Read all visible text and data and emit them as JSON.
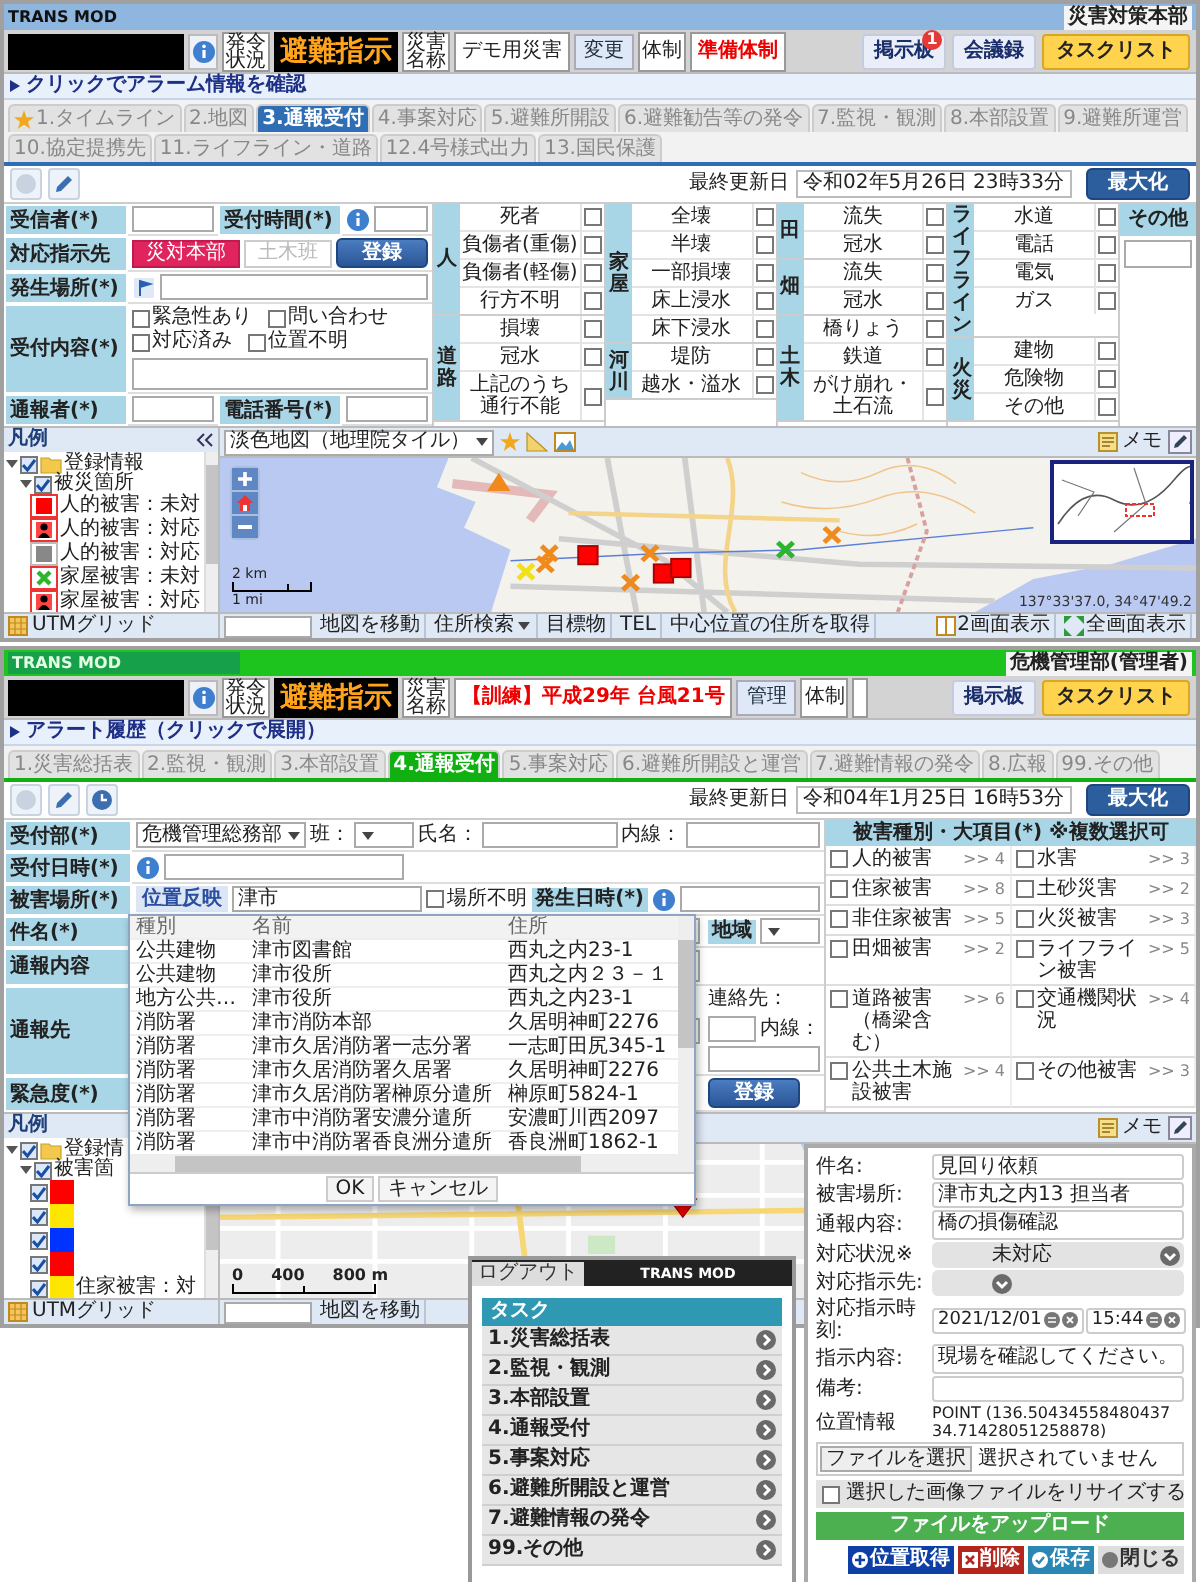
{
  "top_screen": {
    "app_title": "TRANS MOD",
    "user": "災害対策本部",
    "header": {
      "issue_label": "発令状況",
      "issue_banner": "避難指示",
      "disaster_label": "災害名称",
      "disaster_name": "デモ用災害",
      "change_button": "変更",
      "system_label": "体制",
      "system_value": "準備体制"
    },
    "buttons": [
      {
        "label": "掲示板",
        "kind": "board",
        "badge": "1"
      },
      {
        "label": "会議録",
        "kind": "board"
      },
      {
        "label": "タスクリスト",
        "kind": "task"
      }
    ],
    "alarm_bar": "クリックでアラーム情報を確認",
    "tabs": [
      {
        "label": "1.タイムライン",
        "starred": true,
        "selected": false
      },
      {
        "label": "2.地図",
        "starred": false,
        "selected": false
      },
      {
        "label": "3.通報受付",
        "starred": false,
        "selected": true
      },
      {
        "label": "4.事案対応",
        "starred": false,
        "selected": false
      },
      {
        "label": "5.避難所開設",
        "starred": false,
        "selected": false
      },
      {
        "label": "6.避難勧告等の発令",
        "starred": false,
        "selected": false
      },
      {
        "label": "7.監視・観測",
        "starred": false,
        "selected": false
      },
      {
        "label": "8.本部設置",
        "starred": false,
        "selected": false
      },
      {
        "label": "9.避難所運営",
        "starred": false,
        "selected": false
      },
      {
        "label": "10.協定提携先",
        "starred": false,
        "selected": false
      },
      {
        "label": "11.ライフライン・道路",
        "starred": false,
        "selected": false
      },
      {
        "label": "12.4号様式出力",
        "starred": false,
        "selected": false
      },
      {
        "label": "13.国民保護",
        "starred": false,
        "selected": false
      }
    ],
    "maximize_button": "最大化",
    "last_updated": {
      "label": "最終更新日",
      "value": "令和02年5月26日 23時33分"
    },
    "form": {
      "receiver_label": "受信者(*)",
      "time_label": "受付時間(*)",
      "assign_label": "対応指示先",
      "assignees": [
        {
          "label": "災対本部",
          "selected": true
        },
        {
          "label": "土木班",
          "selected": false
        }
      ],
      "place_label": "発生場所(*)",
      "content_label": "受付内容(*)",
      "flags": [
        {
          "label": "緊急性あり",
          "checked": false
        },
        {
          "label": "問い合わせ",
          "checked": false
        },
        {
          "label": "対応済み",
          "checked": false
        },
        {
          "label": "位置不明",
          "checked": false
        }
      ],
      "reporter_label": "通報者(*)",
      "phone_label": "電話番号(*)",
      "submit_button": "登録"
    },
    "categories": [
      {
        "groups": [
          {
            "label": "人",
            "items": [
              {
                "label": "死者",
                "checked": false
              },
              {
                "label": "負傷者(重傷)",
                "checked": false
              },
              {
                "label": "負傷者(軽傷)",
                "checked": false
              },
              {
                "label": "行方不明",
                "checked": false
              }
            ]
          },
          {
            "label": "道路",
            "items": [
              {
                "label": "損壊",
                "checked": false
              },
              {
                "label": "冠水",
                "checked": false
              },
              {
                "label": "上記のうち通行不能",
                "checked": false
              }
            ]
          }
        ]
      },
      {
        "groups": [
          {
            "label": "家屋",
            "items": [
              {
                "label": "全壊",
                "checked": false
              },
              {
                "label": "半壊",
                "checked": false
              },
              {
                "label": "一部損壊",
                "checked": false
              },
              {
                "label": "床上浸水",
                "checked": false
              },
              {
                "label": "床下浸水",
                "checked": false
              }
            ]
          },
          {
            "label": "河川",
            "items": [
              {
                "label": "堤防",
                "checked": false
              },
              {
                "label": "越水・溢水",
                "checked": false
              }
            ]
          }
        ]
      },
      {
        "groups": [
          {
            "label": "田",
            "items": [
              {
                "label": "流失",
                "checked": false
              },
              {
                "label": "冠水",
                "checked": false
              }
            ]
          },
          {
            "label": "畑",
            "items": [
              {
                "label": "流失",
                "checked": false
              },
              {
                "label": "冠水",
                "checked": false
              }
            ]
          },
          {
            "label": "土木",
            "items": [
              {
                "label": "橋りょう",
                "checked": false
              },
              {
                "label": "鉄道",
                "checked": false
              },
              {
                "label": "がけ崩れ・土石流",
                "checked": false
              }
            ]
          }
        ]
      },
      {
        "groups": [
          {
            "label": "ライフライン",
            "items": [
              {
                "label": "水道",
                "checked": false
              },
              {
                "label": "電話",
                "checked": false
              },
              {
                "label": "電気",
                "checked": false
              },
              {
                "label": "ガス",
                "checked": false
              }
            ]
          },
          {
            "label": "火災",
            "items": [
              {
                "label": "建物",
                "checked": false
              },
              {
                "label": "危険物",
                "checked": false
              },
              {
                "label": "その他",
                "checked": false
              }
            ]
          }
        ]
      }
    ],
    "other_category": "その他",
    "map": {
      "legend_title": "凡例",
      "tree": [
        {
          "label": "登録情報",
          "checked": true,
          "expanded": true,
          "children": [
            {
              "label": "被災箇所",
              "checked": true,
              "expanded": true,
              "children": [
                {
                  "label": "人的被害：未対",
                  "kind": "square"
                },
                {
                  "label": "人的被害：対応",
                  "kind": "person"
                },
                {
                  "label": "人的被害：対応",
                  "kind": "grey-square"
                },
                {
                  "label": "家屋被害：未対",
                  "kind": "cross"
                },
                {
                  "label": "家屋被害：対応",
                  "kind": "person"
                }
              ]
            }
          ]
        }
      ],
      "grid_label": "UTMグリッド",
      "base_map": "淡色地図（地理院タイル）",
      "memo_button": "メモ",
      "scale": [
        "2 km",
        "1 mi"
      ],
      "coordinates": "137°33'37.0, 34°47'49.2",
      "tools": [
        {
          "label": "地図を移動",
          "dropdown": false
        },
        {
          "label": "住所検索",
          "dropdown": true
        },
        {
          "label": "目標物",
          "dropdown": false
        },
        {
          "label": "TEL",
          "dropdown": false
        },
        {
          "label": "中心位置の住所を取得",
          "dropdown": false
        }
      ],
      "view_buttons": [
        {
          "label": "2画面表示",
          "kind": "split"
        },
        {
          "label": "全画面表示",
          "kind": "full"
        }
      ]
    }
  },
  "bottom_screen": {
    "app_title": "TRANS MOD",
    "user": "危機管理部(管理者)",
    "header": {
      "issue_label": "発令状況",
      "issue_banner": "避難指示",
      "disaster_label": "災害名称",
      "disaster_name": "【訓練】平成29年 台風21号",
      "change_button": "管理",
      "system_label": "体制"
    },
    "buttons": [
      {
        "label": "掲示板",
        "kind": "board"
      },
      {
        "label": "タスクリスト",
        "kind": "task"
      }
    ],
    "alarm_bar": "アラート履歴（クリックで展開）",
    "tabs": [
      {
        "label": "1.災害総括表",
        "selected": false
      },
      {
        "label": "2.監視・観測",
        "selected": false
      },
      {
        "label": "3.本部設置",
        "selected": false
      },
      {
        "label": "4.通報受付",
        "selected": true
      },
      {
        "label": "5.事案対応",
        "selected": false
      },
      {
        "label": "6.避難所開設と運営",
        "selected": false
      },
      {
        "label": "7.避難情報の発令",
        "selected": false
      },
      {
        "label": "8.広報",
        "selected": false
      },
      {
        "label": "99.その他",
        "selected": false
      }
    ],
    "maximize_button": "最大化",
    "last_updated": {
      "label": "最終更新日",
      "value": "令和04年1月25日 16時53分"
    },
    "form": {
      "dept_label": "受付部(*)",
      "dept_value": "危機管理総務部",
      "team_label": "班：",
      "name_label": "氏名：",
      "ext_label": "内線：",
      "received_label": "受付日時(*)",
      "place_label": "被害場所(*)",
      "place_button": "位置反映",
      "place_value": "津市",
      "place_unknown": {
        "label": "場所不明",
        "checked": false
      },
      "occurred_label": "発生日時(*)",
      "subject_label": "件名(*)",
      "area_label": "地域",
      "content_label": "通報内容",
      "contact_label": "通報先",
      "contact_tel_label": "連絡先：",
      "contact_ext_label": "内線：",
      "urgency_label": "緊急度(*)",
      "submit_button": "登録"
    },
    "damage_types": {
      "title": "被害種別・大項目(*) ※複数選択可",
      "items": [
        {
          "label": "人的被害",
          "count": ">> 4",
          "checked": false
        },
        {
          "label": "水害",
          "count": ">> 3",
          "checked": false
        },
        {
          "label": "住家被害",
          "count": ">> 8",
          "checked": false
        },
        {
          "label": "土砂災害",
          "count": ">> 2",
          "checked": false
        },
        {
          "label": "非住家被害",
          "count": ">> 5",
          "checked": false
        },
        {
          "label": "火災被害",
          "count": ">> 3",
          "checked": false
        },
        {
          "label": "田畑被害",
          "count": ">> 2",
          "checked": false
        },
        {
          "label": "ライフライン被害",
          "count": ">> 5",
          "checked": false
        },
        {
          "label": "道路被害（橋梁含む）",
          "count": ">> 6",
          "checked": false
        },
        {
          "label": "交通機関状況",
          "count": ">> 4",
          "checked": false
        },
        {
          "label": "公共土木施設被害",
          "count": ">> 4",
          "checked": false
        },
        {
          "label": "その他被害",
          "count": ">> 3",
          "checked": false
        }
      ]
    },
    "place_search": {
      "columns": [
        "種別",
        "名前",
        "住所"
      ],
      "rows": [
        [
          "公共建物",
          "津市図書館",
          "西丸之内23-1"
        ],
        [
          "公共建物",
          "津市役所",
          "西丸之内２３－１"
        ],
        [
          "地方公共…",
          "津市役所",
          "西丸之内23-1"
        ],
        [
          "消防署",
          "津市消防本部",
          "久居明神町2276"
        ],
        [
          "消防署",
          "津市久居消防署一志分署",
          "一志町田尻345-1"
        ],
        [
          "消防署",
          "津市久居消防署久居署",
          "久居明神町2276"
        ],
        [
          "消防署",
          "津市久居消防署榊原分遣所",
          "榊原町5824-1"
        ],
        [
          "消防署",
          "津市中消防署安濃分遣所",
          "安濃町川西2097"
        ],
        [
          "消防署",
          "津市中消防署香良洲分遣所",
          "香良洲町1862-1"
        ]
      ],
      "buttons": [
        "OK",
        "キャンセル"
      ]
    },
    "map": {
      "legend_title": "凡例",
      "tree": [
        {
          "label": "登録情",
          "checked": true,
          "expanded": true,
          "children": [
            {
              "label": "被害箇",
              "checked": true,
              "expanded": true,
              "children": [
                {
                  "checked": true,
                  "color": "#ff0000"
                },
                {
                  "checked": true,
                  "color": "#ffe600"
                },
                {
                  "checked": true,
                  "color": "#0033ff"
                },
                {
                  "checked": true,
                  "color": "#ff0000"
                },
                {
                  "checked": true,
                  "color": "#ffe600",
                  "label": "住家被害：対"
                }
              ]
            }
          ]
        }
      ],
      "grid_label": "UTMグリッド",
      "memo_button": "メモ",
      "scale": [
        "0",
        "400",
        "800 m"
      ],
      "tools": [
        {
          "label": "地図を移動",
          "dropdown": false
        }
      ]
    }
  },
  "phones": {
    "task_menu": {
      "logout_button": "ログアウト",
      "title": "TRANS MOD",
      "section": "タスク",
      "items": [
        "1.災害総括表",
        "2.監視・観測",
        "3.本部設置",
        "4.通報受付",
        "5.事案対応",
        "6.避難所開設と運営",
        "7.避難情報の発令",
        "99.その他"
      ]
    },
    "report_form": {
      "fields": [
        {
          "label": "件名:",
          "kind": "text",
          "value": "見回り依頼"
        },
        {
          "label": "被害場所:",
          "kind": "text",
          "value": "津市丸之内13 担当者"
        },
        {
          "label": "通報内容:",
          "kind": "textarea",
          "value": "橋の損傷確認"
        },
        {
          "label": "対応状況※",
          "kind": "select",
          "value": "未対応"
        },
        {
          "label": "対応指示先:",
          "kind": "select"
        },
        {
          "label": "対応指示時刻:",
          "kind": "datetime",
          "values": [
            "2021/12/01",
            "15:44"
          ]
        },
        {
          "label": "指示内容:",
          "kind": "textarea",
          "value": "現場を確認してください。"
        },
        {
          "label": "備考:",
          "kind": "text"
        },
        {
          "label": "位置情報",
          "kind": "plain",
          "value": "POINT (136.50434558480437 34.71428051258878)"
        }
      ],
      "file_button": "ファイルを選択",
      "file_status": "選択されていません",
      "resize": {
        "label": "選択した画像ファイルをリサイズする",
        "checked": false
      },
      "upload_button": "ファイルをアップロード",
      "actions": [
        {
          "label": "位置取得",
          "kind": "locate"
        },
        {
          "label": "削除",
          "kind": "delete"
        },
        {
          "label": "保存",
          "kind": "save"
        },
        {
          "label": "閉じる",
          "kind": "close"
        }
      ]
    }
  }
}
